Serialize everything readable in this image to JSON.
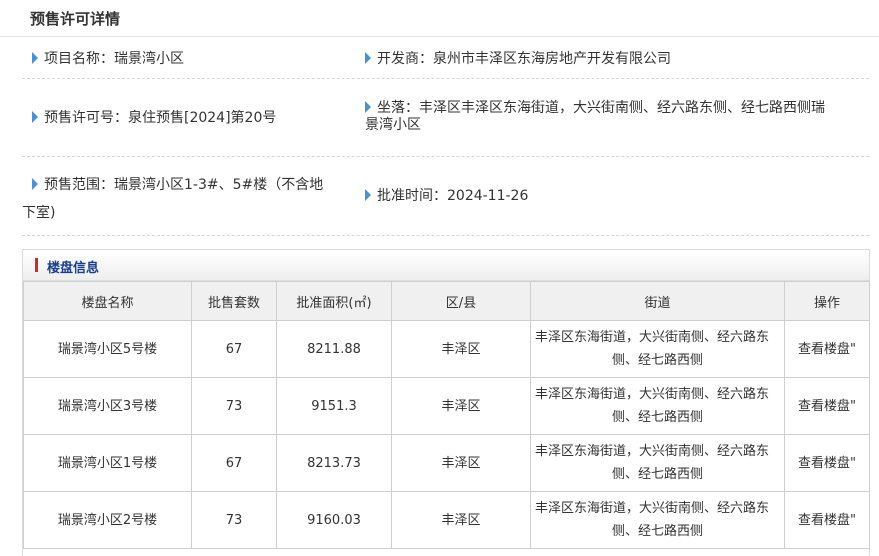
{
  "page": {
    "title": "预售许可详情"
  },
  "info": {
    "project_name": "项目名称：瑞景湾小区",
    "developer": "开发商：泉州市丰泽区东海房地产开发有限公司",
    "permit_no": "预售许可号：泉住预售[2024]第20号",
    "location_line1": "坐落：丰泽区丰泽区东海街道，大兴街南侧、经六路东侧、经七路西侧瑞",
    "location_line2": "景湾小区",
    "scope_line1": "预售范围：瑞景湾小区1-3#、5#楼（不含地",
    "scope_line2": "下室)",
    "approval_time": "批准时间：2024-11-26"
  },
  "building_section": {
    "title": "楼盘信息"
  },
  "table": {
    "headers": [
      "楼盘名称",
      "批售套数",
      "批准面积(㎡)",
      "区/县",
      "街道",
      "操作"
    ],
    "rows": [
      {
        "name": "瑞景湾小区5号楼",
        "units": "67",
        "area": "8211.88",
        "district": "丰泽区",
        "street_line1": "丰泽区东海街道，大兴街南侧、经六路东",
        "street_line2": "侧、经七路西侧",
        "action": "查看楼盘\""
      },
      {
        "name": "瑞景湾小区3号楼",
        "units": "73",
        "area": "9151.3",
        "district": "丰泽区",
        "street_line1": "丰泽区东海街道，大兴街南侧、经六路东",
        "street_line2": "侧、经七路西侧",
        "action": "查看楼盘\""
      },
      {
        "name": "瑞景湾小区1号楼",
        "units": "67",
        "area": "8213.73",
        "district": "丰泽区",
        "street_line1": "丰泽区东海街道，大兴街南侧、经六路东",
        "street_line2": "侧、经七路西侧",
        "action": "查看楼盘\""
      },
      {
        "name": "瑞景湾小区2号楼",
        "units": "73",
        "area": "9160.03",
        "district": "丰泽区",
        "street_line1": "丰泽区东海街道，大兴街南侧、经六路东",
        "street_line2": "侧、经七路西侧",
        "action": "查看楼盘\""
      }
    ]
  },
  "icons": {
    "bullet": "blue-triangle-bullet-icon",
    "section_marker": "red-bar-icon"
  },
  "colors": {
    "bullet": "#4a90d9",
    "section_marker": "#d9281c",
    "section_title": "#1a3f8c"
  }
}
